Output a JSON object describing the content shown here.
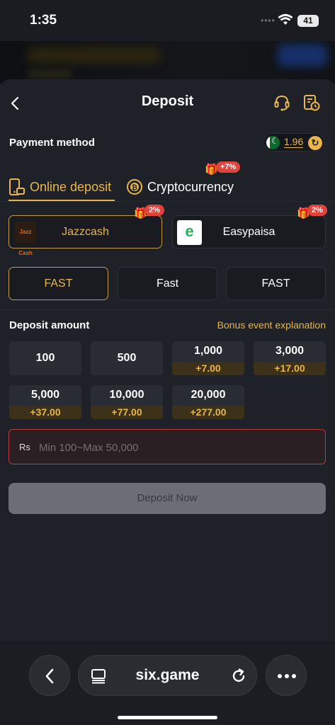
{
  "status": {
    "time": "1:35",
    "battery": "41"
  },
  "header": {
    "title": "Deposit"
  },
  "payment": {
    "label": "Payment method",
    "balance": "1.96"
  },
  "tabs": [
    {
      "label": "Online deposit",
      "selected": true
    },
    {
      "label": "Cryptocurrency",
      "badge": "+7%"
    }
  ],
  "methods": [
    {
      "name": "Jazzcash",
      "badge": "2%",
      "logo_text": "Jazz Cash",
      "selected": true
    },
    {
      "name": "Easypaisa",
      "badge": "2%",
      "logo_text": "e",
      "selected": false
    }
  ],
  "channels": [
    {
      "label": "FAST",
      "selected": true
    },
    {
      "label": "Fast",
      "selected": false
    },
    {
      "label": "FAST",
      "selected": false
    }
  ],
  "deposit": {
    "label": "Deposit amount",
    "bonus_link": "Bonus event explanation",
    "amounts": [
      {
        "value": "100",
        "bonus": ""
      },
      {
        "value": "500",
        "bonus": ""
      },
      {
        "value": "1,000",
        "bonus": "+7.00"
      },
      {
        "value": "3,000",
        "bonus": "+17.00"
      },
      {
        "value": "5,000",
        "bonus": "+37.00"
      },
      {
        "value": "10,000",
        "bonus": "+77.00"
      },
      {
        "value": "20,000",
        "bonus": "+277.00"
      }
    ],
    "currency_prefix": "Rs",
    "placeholder": "Min 100~Max 50,000",
    "button_label": "Deposit Now"
  },
  "browser": {
    "url": "six.game"
  },
  "colors": {
    "accent": "#e8b64c",
    "badge": "#e0433b",
    "error_border": "#c0393a",
    "background": "#1f2128"
  }
}
